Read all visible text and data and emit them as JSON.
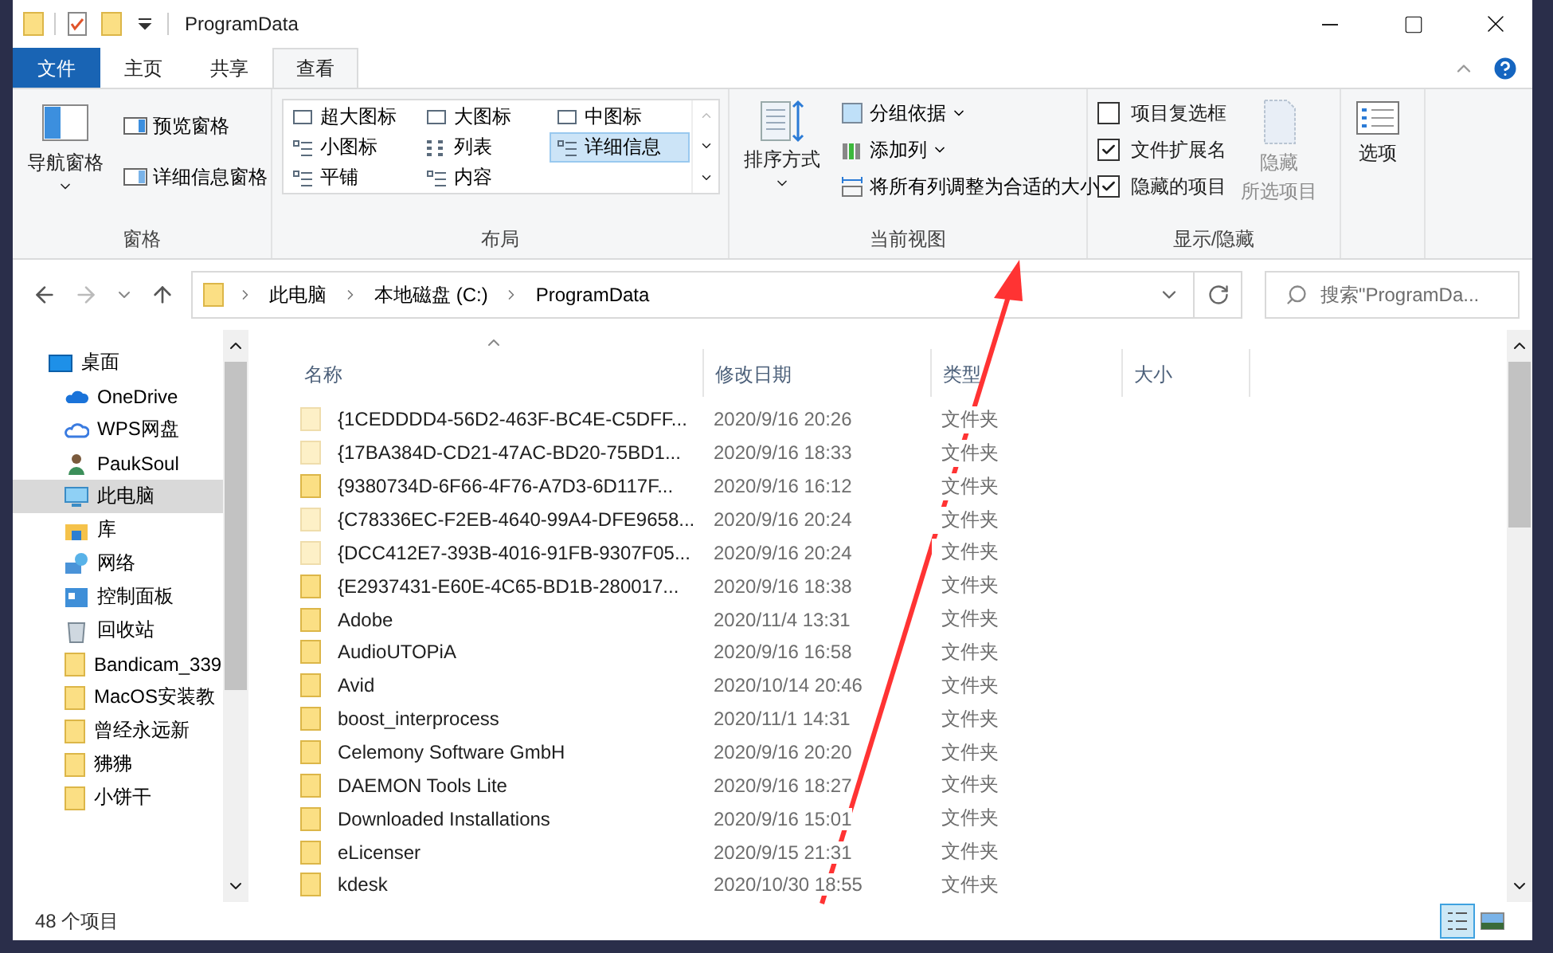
{
  "window": {
    "title": "ProgramData"
  },
  "ribbon_tabs": [
    {
      "label": "文件",
      "kind": "file",
      "selected": false
    },
    {
      "label": "主页",
      "kind": "tab",
      "selected": false
    },
    {
      "label": "共享",
      "kind": "tab",
      "selected": false
    },
    {
      "label": "查看",
      "kind": "tab",
      "selected": true
    }
  ],
  "ribbon": {
    "pane_group": {
      "title": "窗格",
      "navigation_pane": "导航窗格",
      "preview_pane": "预览窗格",
      "details_pane": "详细信息窗格"
    },
    "layout_group": {
      "title": "布局",
      "options": [
        {
          "label": "超大图标",
          "selected": false
        },
        {
          "label": "大图标",
          "selected": false
        },
        {
          "label": "中图标",
          "selected": false
        },
        {
          "label": "小图标",
          "selected": false
        },
        {
          "label": "列表",
          "selected": false
        },
        {
          "label": "详细信息",
          "selected": true
        },
        {
          "label": "平铺",
          "selected": false
        },
        {
          "label": "内容",
          "selected": false
        }
      ]
    },
    "current_view_group": {
      "title": "当前视图",
      "sort_by": "排序方式",
      "group_by": "分组依据",
      "add_columns": "添加列",
      "size_columns": "将所有列调整为合适的大小"
    },
    "show_hide_group": {
      "title": "显示/隐藏",
      "checkboxes": [
        {
          "label": "项目复选框",
          "checked": false
        },
        {
          "label": "文件扩展名",
          "checked": true
        },
        {
          "label": "隐藏的项目",
          "checked": true
        }
      ],
      "hide_selected": {
        "label_1": "隐藏",
        "label_2": "所选项目",
        "disabled": true
      }
    },
    "options": "选项"
  },
  "address_bar": {
    "path": [
      "此电脑",
      "本地磁盘 (C:)",
      "ProgramData"
    ]
  },
  "search": {
    "placeholder": "搜索\"ProgramDa..."
  },
  "sidebar": {
    "items": [
      {
        "label": "桌面",
        "selected": false,
        "children": [
          {
            "label": "OneDrive",
            "selected": false
          },
          {
            "label": "WPS网盘",
            "selected": false
          },
          {
            "label": "PaukSoul",
            "selected": false
          },
          {
            "label": "此电脑",
            "selected": true
          },
          {
            "label": "库",
            "selected": false
          },
          {
            "label": "网络",
            "selected": false
          },
          {
            "label": "控制面板",
            "selected": false
          },
          {
            "label": "回收站",
            "selected": false
          },
          {
            "label": "Bandicam_339",
            "selected": false
          },
          {
            "label": "MacOS安装教",
            "selected": false
          },
          {
            "label": "曾经永远新",
            "selected": false
          },
          {
            "label": "狒狒",
            "selected": false
          },
          {
            "label": "小饼干",
            "selected": false
          }
        ]
      }
    ]
  },
  "table": {
    "columns": [
      "名称",
      "修改日期",
      "类型",
      "大小"
    ],
    "rows": [
      {
        "name": "{1CEDDDD4-56D2-463F-BC4E-C5DFF...",
        "modified": "2020/9/16 20:26",
        "type": "文件夹",
        "hidden": true
      },
      {
        "name": "{17BA384D-CD21-47AC-BD20-75BD1...",
        "modified": "2020/9/16 18:33",
        "type": "文件夹",
        "hidden": true
      },
      {
        "name": "{9380734D-6F66-4F76-A7D3-6D117F...",
        "modified": "2020/9/16 16:12",
        "type": "文件夹",
        "hidden": false
      },
      {
        "name": "{C78336EC-F2EB-4640-99A4-DFE9658...",
        "modified": "2020/9/16 20:24",
        "type": "文件夹",
        "hidden": true
      },
      {
        "name": "{DCC412E7-393B-4016-91FB-9307F05...",
        "modified": "2020/9/16 20:24",
        "type": "文件夹",
        "hidden": true
      },
      {
        "name": "{E2937431-E60E-4C65-BD1B-280017...",
        "modified": "2020/9/16 18:38",
        "type": "文件夹",
        "hidden": false
      },
      {
        "name": "Adobe",
        "modified": "2020/11/4 13:31",
        "type": "文件夹",
        "hidden": false
      },
      {
        "name": "AudioUTOPiA",
        "modified": "2020/9/16 16:58",
        "type": "文件夹",
        "hidden": false
      },
      {
        "name": "Avid",
        "modified": "2020/10/14 20:46",
        "type": "文件夹",
        "hidden": false
      },
      {
        "name": "boost_interprocess",
        "modified": "2020/11/1 14:31",
        "type": "文件夹",
        "hidden": false
      },
      {
        "name": "Celemony Software GmbH",
        "modified": "2020/9/16 20:20",
        "type": "文件夹",
        "hidden": false
      },
      {
        "name": "DAEMON Tools Lite",
        "modified": "2020/9/16 18:27",
        "type": "文件夹",
        "hidden": false
      },
      {
        "name": "Downloaded Installations",
        "modified": "2020/9/16 15:01",
        "type": "文件夹",
        "hidden": false
      },
      {
        "name": "eLicenser",
        "modified": "2020/9/15 21:31",
        "type": "文件夹",
        "hidden": false
      },
      {
        "name": "kdesk",
        "modified": "2020/10/30 18:55",
        "type": "文件夹",
        "hidden": false
      }
    ]
  },
  "status_bar": {
    "count": "48 个项目",
    "views": [
      {
        "kind": "details",
        "selected": true
      },
      {
        "kind": "large-icons",
        "selected": false
      }
    ]
  }
}
